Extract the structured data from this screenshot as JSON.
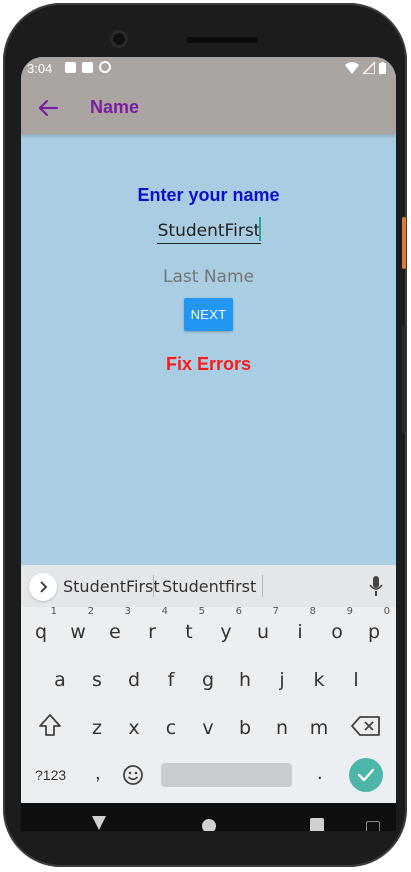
{
  "status_bar": {
    "time": "3:04",
    "icons": [
      "notification-a-icon",
      "sd-card-icon",
      "sync-icon",
      "wifi-icon",
      "cell-signal-icon",
      "battery-icon"
    ]
  },
  "app_bar": {
    "title": "Name",
    "back_icon": "arrow-back-icon",
    "title_color": "#7b1fa2",
    "background": "#aba5a2"
  },
  "form": {
    "prompt": "Enter your name",
    "first_name_value": "StudentFirst",
    "last_name_placeholder": "Last Name",
    "next_label": "NEXT",
    "error_text": "Fix Errors",
    "background": "#a9cde2",
    "prompt_color": "#1010c8",
    "error_color": "#ff1a1a",
    "button_color": "#2196f3"
  },
  "keyboard": {
    "suggestions": [
      "StudentFirst",
      "Studentfirst"
    ],
    "row1": [
      {
        "k": "q",
        "n": "1"
      },
      {
        "k": "w",
        "n": "2"
      },
      {
        "k": "e",
        "n": "3"
      },
      {
        "k": "r",
        "n": "4"
      },
      {
        "k": "t",
        "n": "5"
      },
      {
        "k": "y",
        "n": "6"
      },
      {
        "k": "u",
        "n": "7"
      },
      {
        "k": "i",
        "n": "8"
      },
      {
        "k": "o",
        "n": "9"
      },
      {
        "k": "p",
        "n": "0"
      }
    ],
    "row2": [
      "a",
      "s",
      "d",
      "f",
      "g",
      "h",
      "j",
      "k",
      "l"
    ],
    "row3": [
      "z",
      "x",
      "c",
      "v",
      "b",
      "n",
      "m"
    ],
    "symbols_key": "?123",
    "comma_key": ",",
    "period_key": ".",
    "done_icon": "check-icon",
    "accent": "#4db6a8"
  },
  "nav_bar": {
    "icons": [
      "nav-back-icon",
      "nav-home-icon",
      "nav-recents-icon"
    ]
  }
}
